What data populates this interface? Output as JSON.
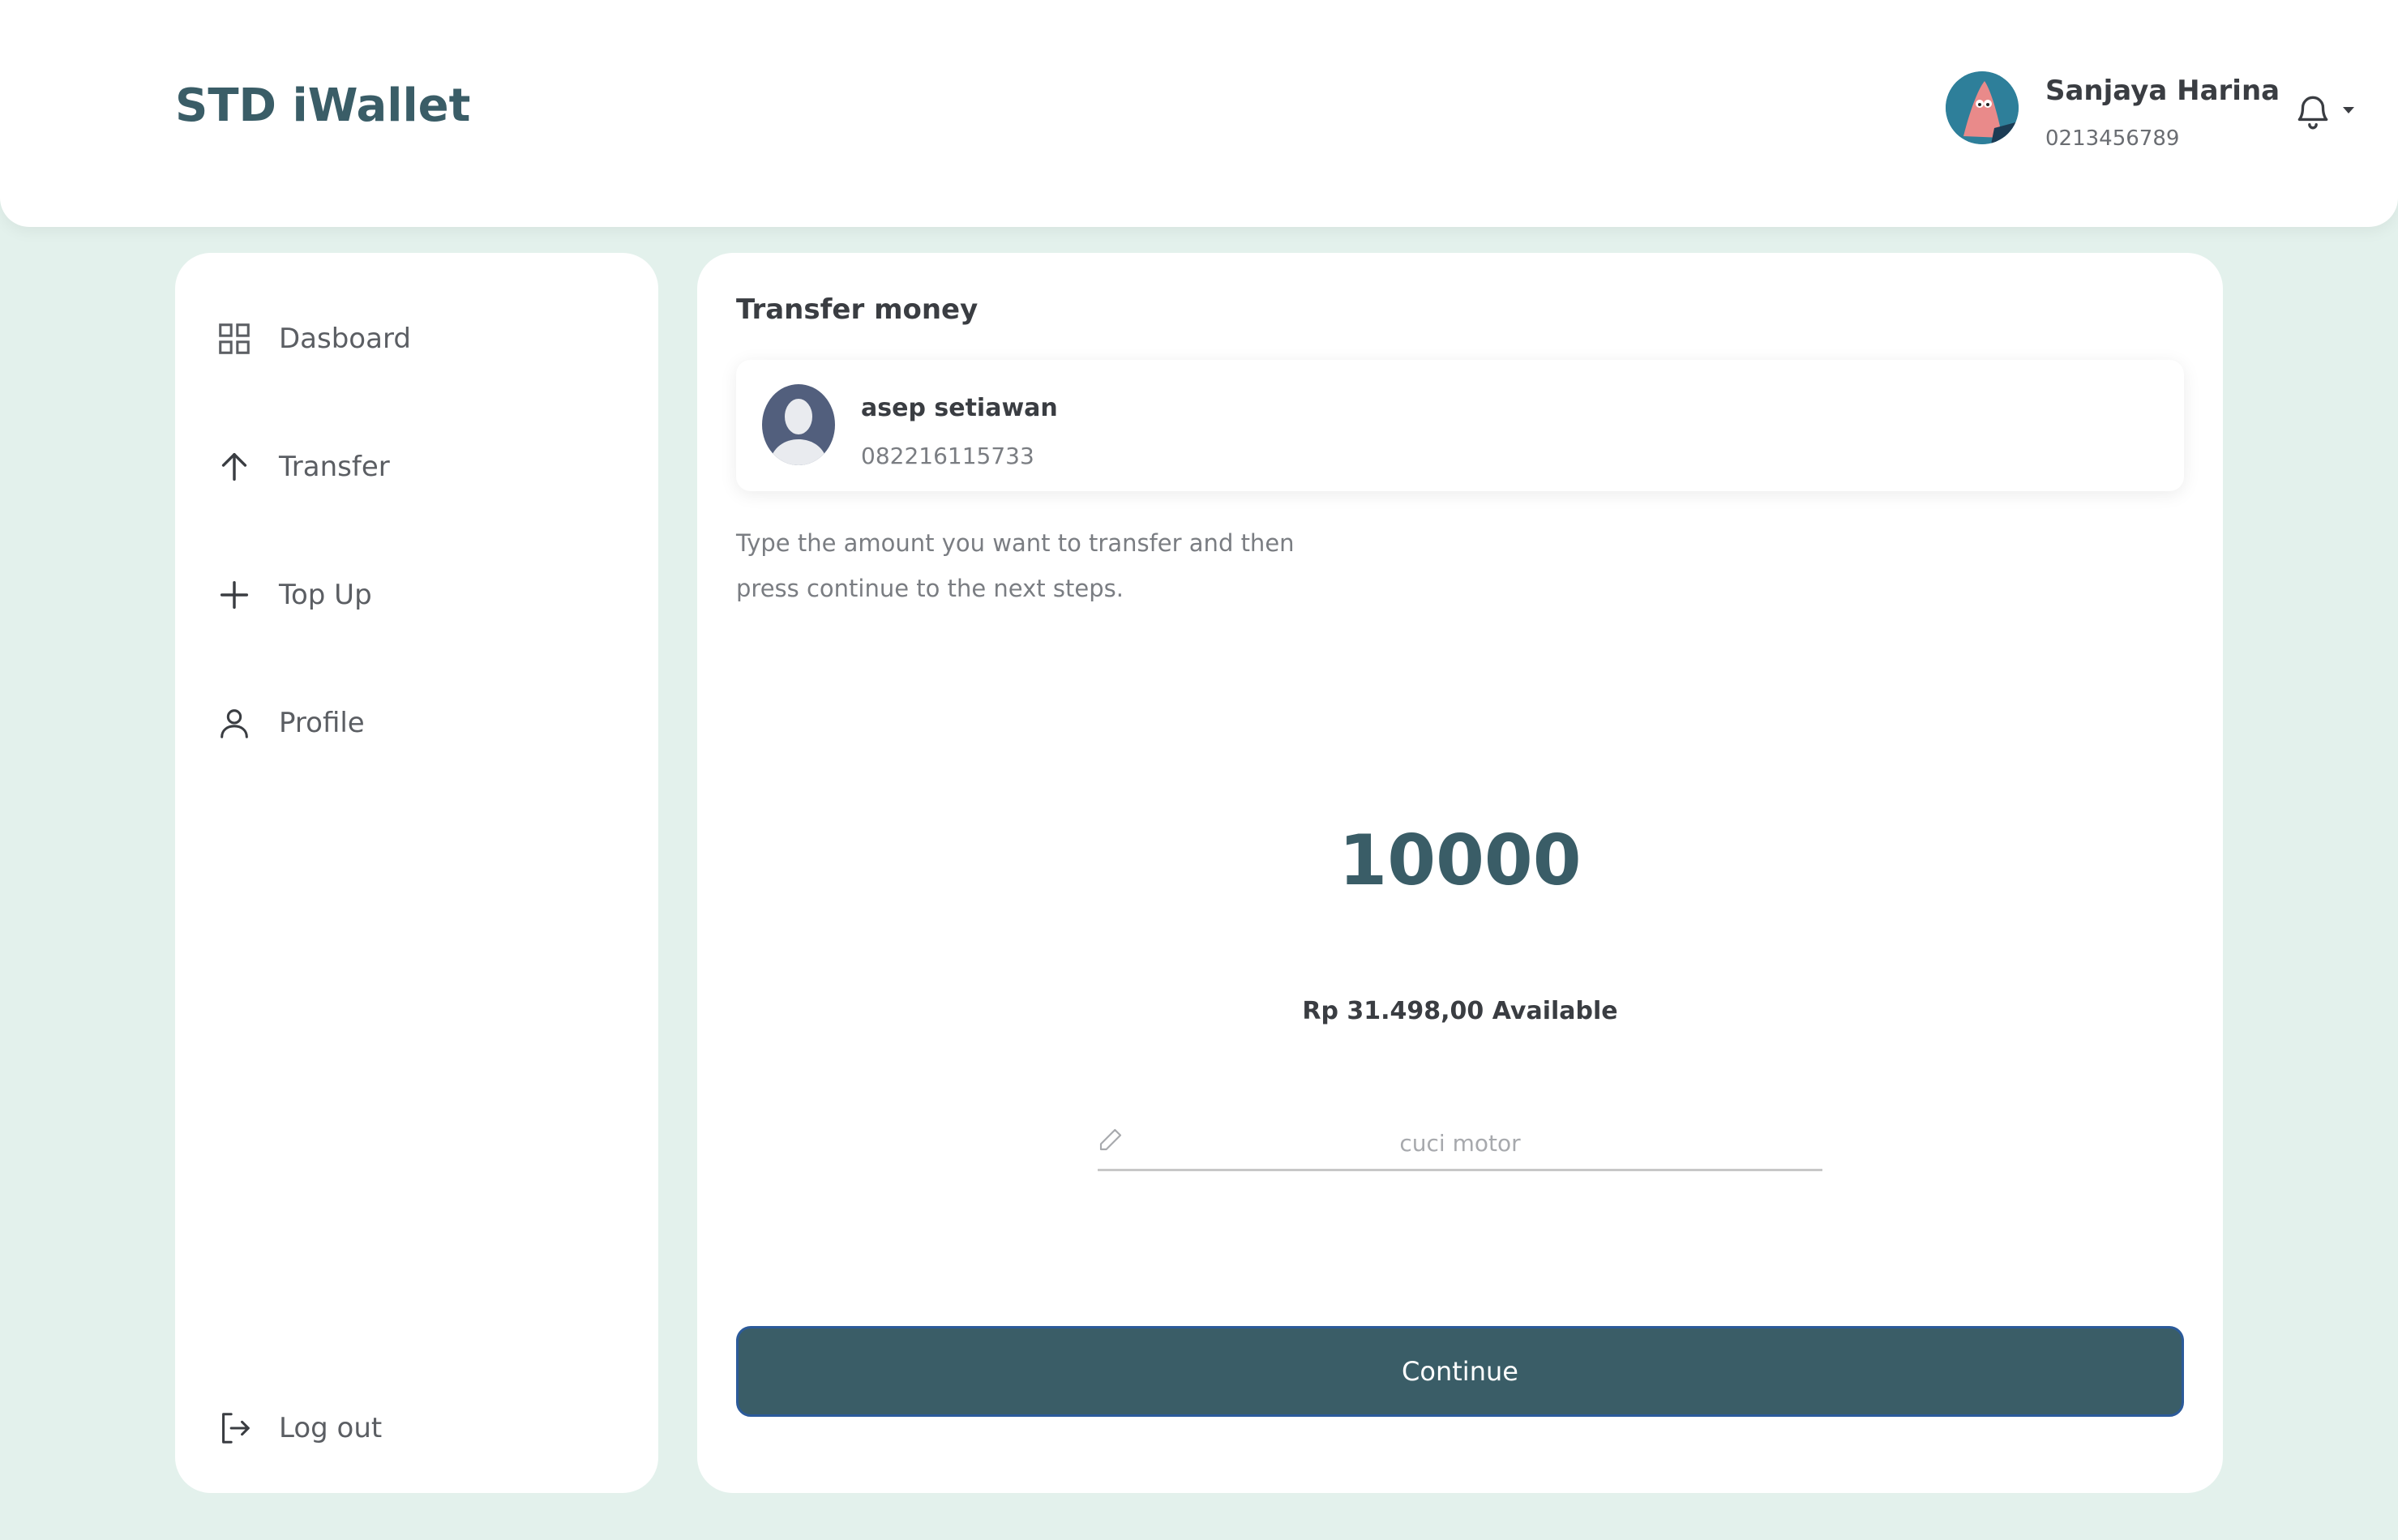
{
  "app": {
    "brand": "STD iWallet"
  },
  "user": {
    "name": "Sanjaya Harina",
    "phone": "0213456789",
    "avatar_icon": "user-avatar-photo"
  },
  "header": {
    "notification_icon": "bell-icon",
    "dropdown_icon": "caret-down-icon"
  },
  "sidebar": {
    "items": [
      {
        "label": "Dasboard",
        "icon": "grid-icon"
      },
      {
        "label": "Transfer",
        "icon": "arrow-up-icon"
      },
      {
        "label": "Top Up",
        "icon": "plus-icon"
      },
      {
        "label": "Profile",
        "icon": "person-icon"
      }
    ],
    "logout": {
      "label": "Log out",
      "icon": "logout-icon"
    }
  },
  "main": {
    "title": "Transfer money",
    "recipient": {
      "name": "asep setiawan",
      "phone": "082216115733",
      "avatar_icon": "default-avatar-icon"
    },
    "instructions": "Type the amount you want to transfer and then press continue to the next steps.",
    "amount": "10000",
    "balance": "Rp 31.498,00 Available",
    "notes": {
      "value": "",
      "placeholder": "cuci motor",
      "icon": "pencil-icon"
    },
    "continue_label": "Continue"
  },
  "colors": {
    "background": "#e3f1ec",
    "primary": "#3a5d67",
    "button_border": "#2b5a9a",
    "text": "#3a3d42",
    "muted": "#7a7d82"
  }
}
